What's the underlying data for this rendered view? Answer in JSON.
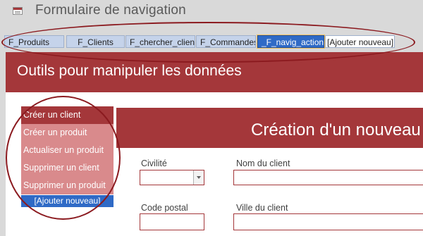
{
  "window": {
    "title": "Formulaire de navigation",
    "icon": "form-icon"
  },
  "tabs": [
    {
      "label": "F_Produits",
      "active": false
    },
    {
      "label": "F_Clients",
      "active": false
    },
    {
      "label": "F_chercher_client",
      "active": false
    },
    {
      "label": "F_Commandes",
      "active": false
    },
    {
      "label": "_F_navig_actions",
      "active": true
    },
    {
      "label": "[Ajouter nouveau]",
      "active": false
    }
  ],
  "header": {
    "title": "Outils pour manipuler les données"
  },
  "side_nav": {
    "items": [
      {
        "label": "Créer un client",
        "selected": true
      },
      {
        "label": "Créer un produit",
        "selected": false
      },
      {
        "label": "Actualiser un produit",
        "selected": false
      },
      {
        "label": "Supprimer un client",
        "selected": false
      },
      {
        "label": "Supprimer un produit",
        "selected": false
      }
    ],
    "add_label": "[Ajouter nouveau]"
  },
  "subform": {
    "title": "Création d'un nouveau",
    "fields": {
      "civilite": {
        "label": "Civilité",
        "value": ""
      },
      "nom": {
        "label": "Nom du client",
        "value": ""
      },
      "code_postal": {
        "label": "Code postal",
        "value": ""
      },
      "ville": {
        "label": "Ville du client",
        "value": ""
      }
    }
  },
  "colors": {
    "accent": "#a4373a",
    "nav_light": "#d98a8c",
    "tab_active": "#2f6ac6",
    "tab_normal": "#c5d3ea",
    "annotation": "#8b1a1f"
  }
}
